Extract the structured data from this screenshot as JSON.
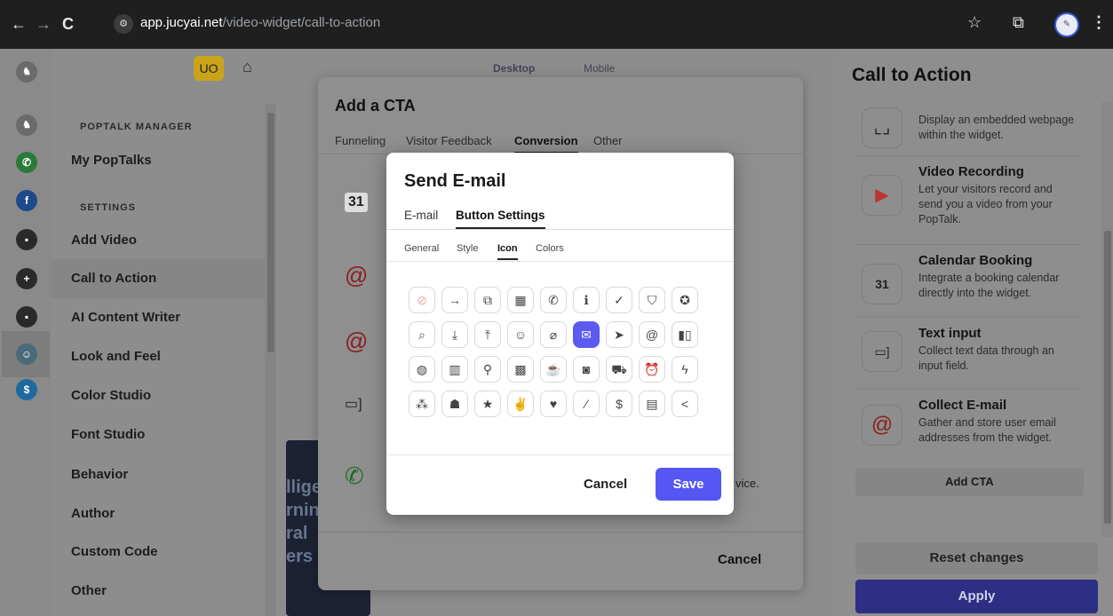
{
  "browser": {
    "url_host": "app.jucyai.net",
    "url_path": "/video-widget/call-to-action",
    "back_icon": "←",
    "forward_icon": "→",
    "reload_icon": "C"
  },
  "sidebar": {
    "badge": "UO",
    "section_manager": "POPTALK MANAGER",
    "section_settings": "SETTINGS",
    "items": [
      {
        "label": "My PopTalks"
      },
      {
        "label": "Add Video"
      },
      {
        "label": "Call to Action"
      },
      {
        "label": "AI Content Writer"
      },
      {
        "label": "Look and Feel"
      },
      {
        "label": "Color Studio"
      },
      {
        "label": "Font Studio"
      },
      {
        "label": "Behavior"
      },
      {
        "label": "Author"
      },
      {
        "label": "Custom Code"
      },
      {
        "label": "Other"
      }
    ]
  },
  "preview": {
    "desktop": "Desktop",
    "mobile": "Mobile",
    "card_text": [
      "llige",
      "rnin",
      "ral",
      "ers"
    ]
  },
  "cta_modal": {
    "title": "Add a CTA",
    "tabs": [
      "Funneling",
      "Visitor Feedback",
      "Conversion",
      "Other"
    ],
    "active_tab": "Conversion",
    "partial_text": "vice.",
    "cancel": "Cancel"
  },
  "dialog": {
    "title": "Send E-mail",
    "tabs": [
      "E-mail",
      "Button Settings"
    ],
    "active_tab": "Button Settings",
    "subtabs": [
      "General",
      "Style",
      "Icon",
      "Colors"
    ],
    "active_subtab": "Icon",
    "selected_icon": "envelope",
    "cancel": "Cancel",
    "save": "Save",
    "accent_color": "#5656f2"
  },
  "right_panel": {
    "title": "Call to Action",
    "items": [
      {
        "name": "",
        "desc": "Display an embedded webpage within the widget."
      },
      {
        "name": "Video Recording",
        "desc": "Let your visitors record and send you a video from your PopTalk."
      },
      {
        "name": "Calendar Booking",
        "desc": "Integrate a booking calendar directly into the widget."
      },
      {
        "name": "Text input",
        "desc": "Collect text data through an input field."
      },
      {
        "name": "Collect E-mail",
        "desc": "Gather and store user email addresses from the widget."
      }
    ],
    "add_cta": "Add CTA",
    "reset": "Reset changes",
    "apply": "Apply"
  }
}
